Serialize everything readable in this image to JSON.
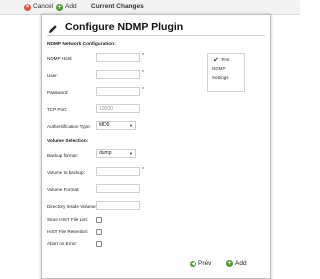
{
  "toolbar": {
    "cancel_label": "Cancel",
    "add_label": "Add",
    "section_title": "Current Changes"
  },
  "dialog": {
    "title": "Configure NDMP Plugin",
    "network_section": "NDMP Network Configuration:",
    "fields": {
      "host_label": "NDMP Host:",
      "user_label": "User:",
      "password_label": "Password:",
      "port_label": "TCP Port:",
      "port_placeholder": "10000",
      "auth_label": "Authentification Type:",
      "auth_value": "MD5"
    },
    "test_box": {
      "line1": "Test",
      "line2": "NDMP",
      "line3": "Settings"
    },
    "volume_section": "Volume Selection:",
    "volume": {
      "backup_format_label": "Backup format:",
      "backup_format_value": "dump",
      "volume_to_backup_label": "Volume to backup:",
      "volume_format_label": "Volume Format:",
      "directory_inside_label": "Directory Inside Volume:",
      "store_hist_label": "Store HIST File List:",
      "hist_retention_label": "HIST File Retention:",
      "abort_label": "Abort on Error:"
    },
    "footer": {
      "prev_label": "Prev",
      "add_label": "Add"
    }
  },
  "colors": {
    "cancel": "#e0533b",
    "add": "#4a9a2e"
  }
}
